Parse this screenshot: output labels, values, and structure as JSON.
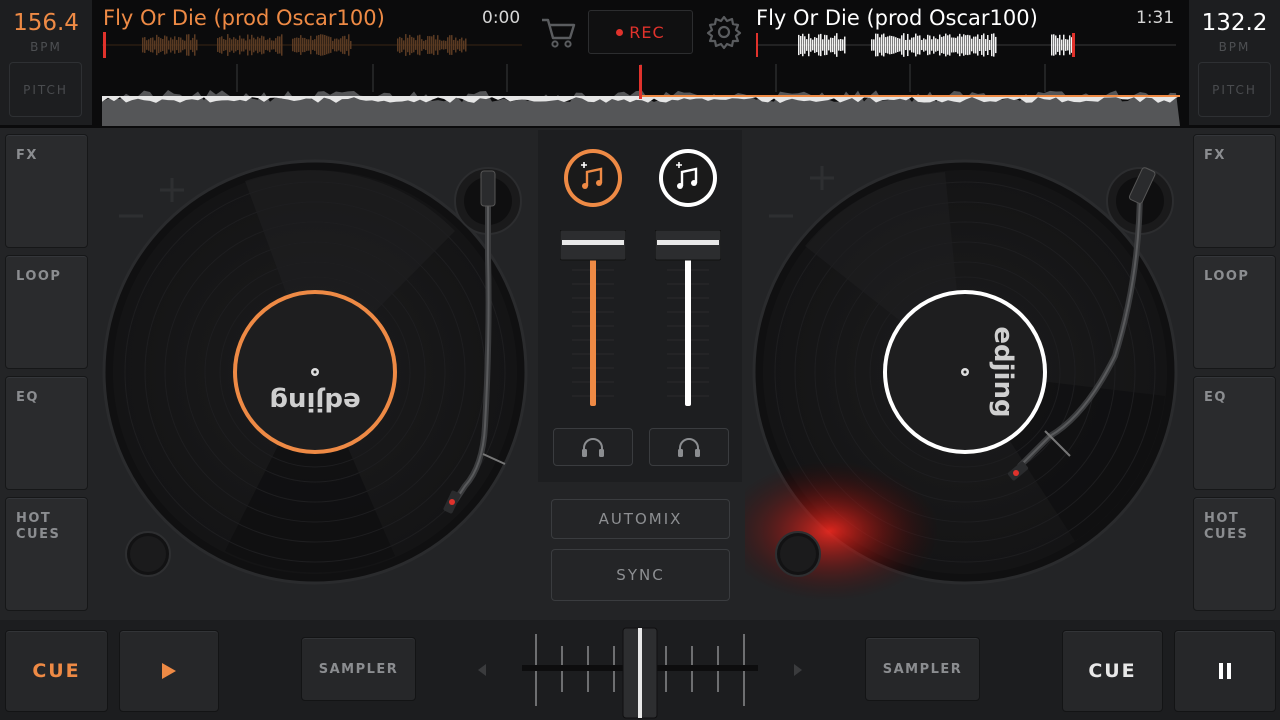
{
  "deck_a": {
    "bpm": "156.4",
    "bpm_unit": "BPM",
    "pitch_label": "PITCH",
    "title": "Fly Or Die (prod Oscar100)",
    "time": "0:00",
    "accent": "#ee8a45",
    "record_label": "edjing",
    "side_buttons": [
      "FX",
      "LOOP",
      "EQ",
      "HOT\nCUES"
    ],
    "cue_label": "CUE",
    "play_icon": "play-icon",
    "sampler_label": "SAMPLER",
    "volume_level": 1.0
  },
  "deck_b": {
    "bpm": "132.2",
    "bpm_unit": "BPM",
    "pitch_label": "PITCH",
    "title": "Fly Or Die (prod Oscar100)",
    "time": "1:31",
    "accent": "#ffffff",
    "record_label": "edjing",
    "side_buttons": [
      "FX",
      "LOOP",
      "EQ",
      "HOT\nCUES"
    ],
    "cue_label": "CUE",
    "pause_icon": "pause-icon",
    "sampler_label": "SAMPLER",
    "volume_level": 1.0
  },
  "toolbar": {
    "rec_label": "REC",
    "cart_icon": "cart-icon",
    "settings_icon": "gear-icon",
    "rec_color": "#e0322c"
  },
  "mixer": {
    "automix_label": "AUTOMIX",
    "sync_label": "SYNC",
    "crossfader_position": 0.5,
    "headphone_icon": "headphones-icon",
    "load_track_icon": "music-note-plus-icon"
  },
  "colors": {
    "background": "#232426",
    "topbar": "#0b0b0c",
    "deck_a_accent": "#ee8a45",
    "deck_b_accent": "#ffffff",
    "playhead": "#e0322c"
  }
}
